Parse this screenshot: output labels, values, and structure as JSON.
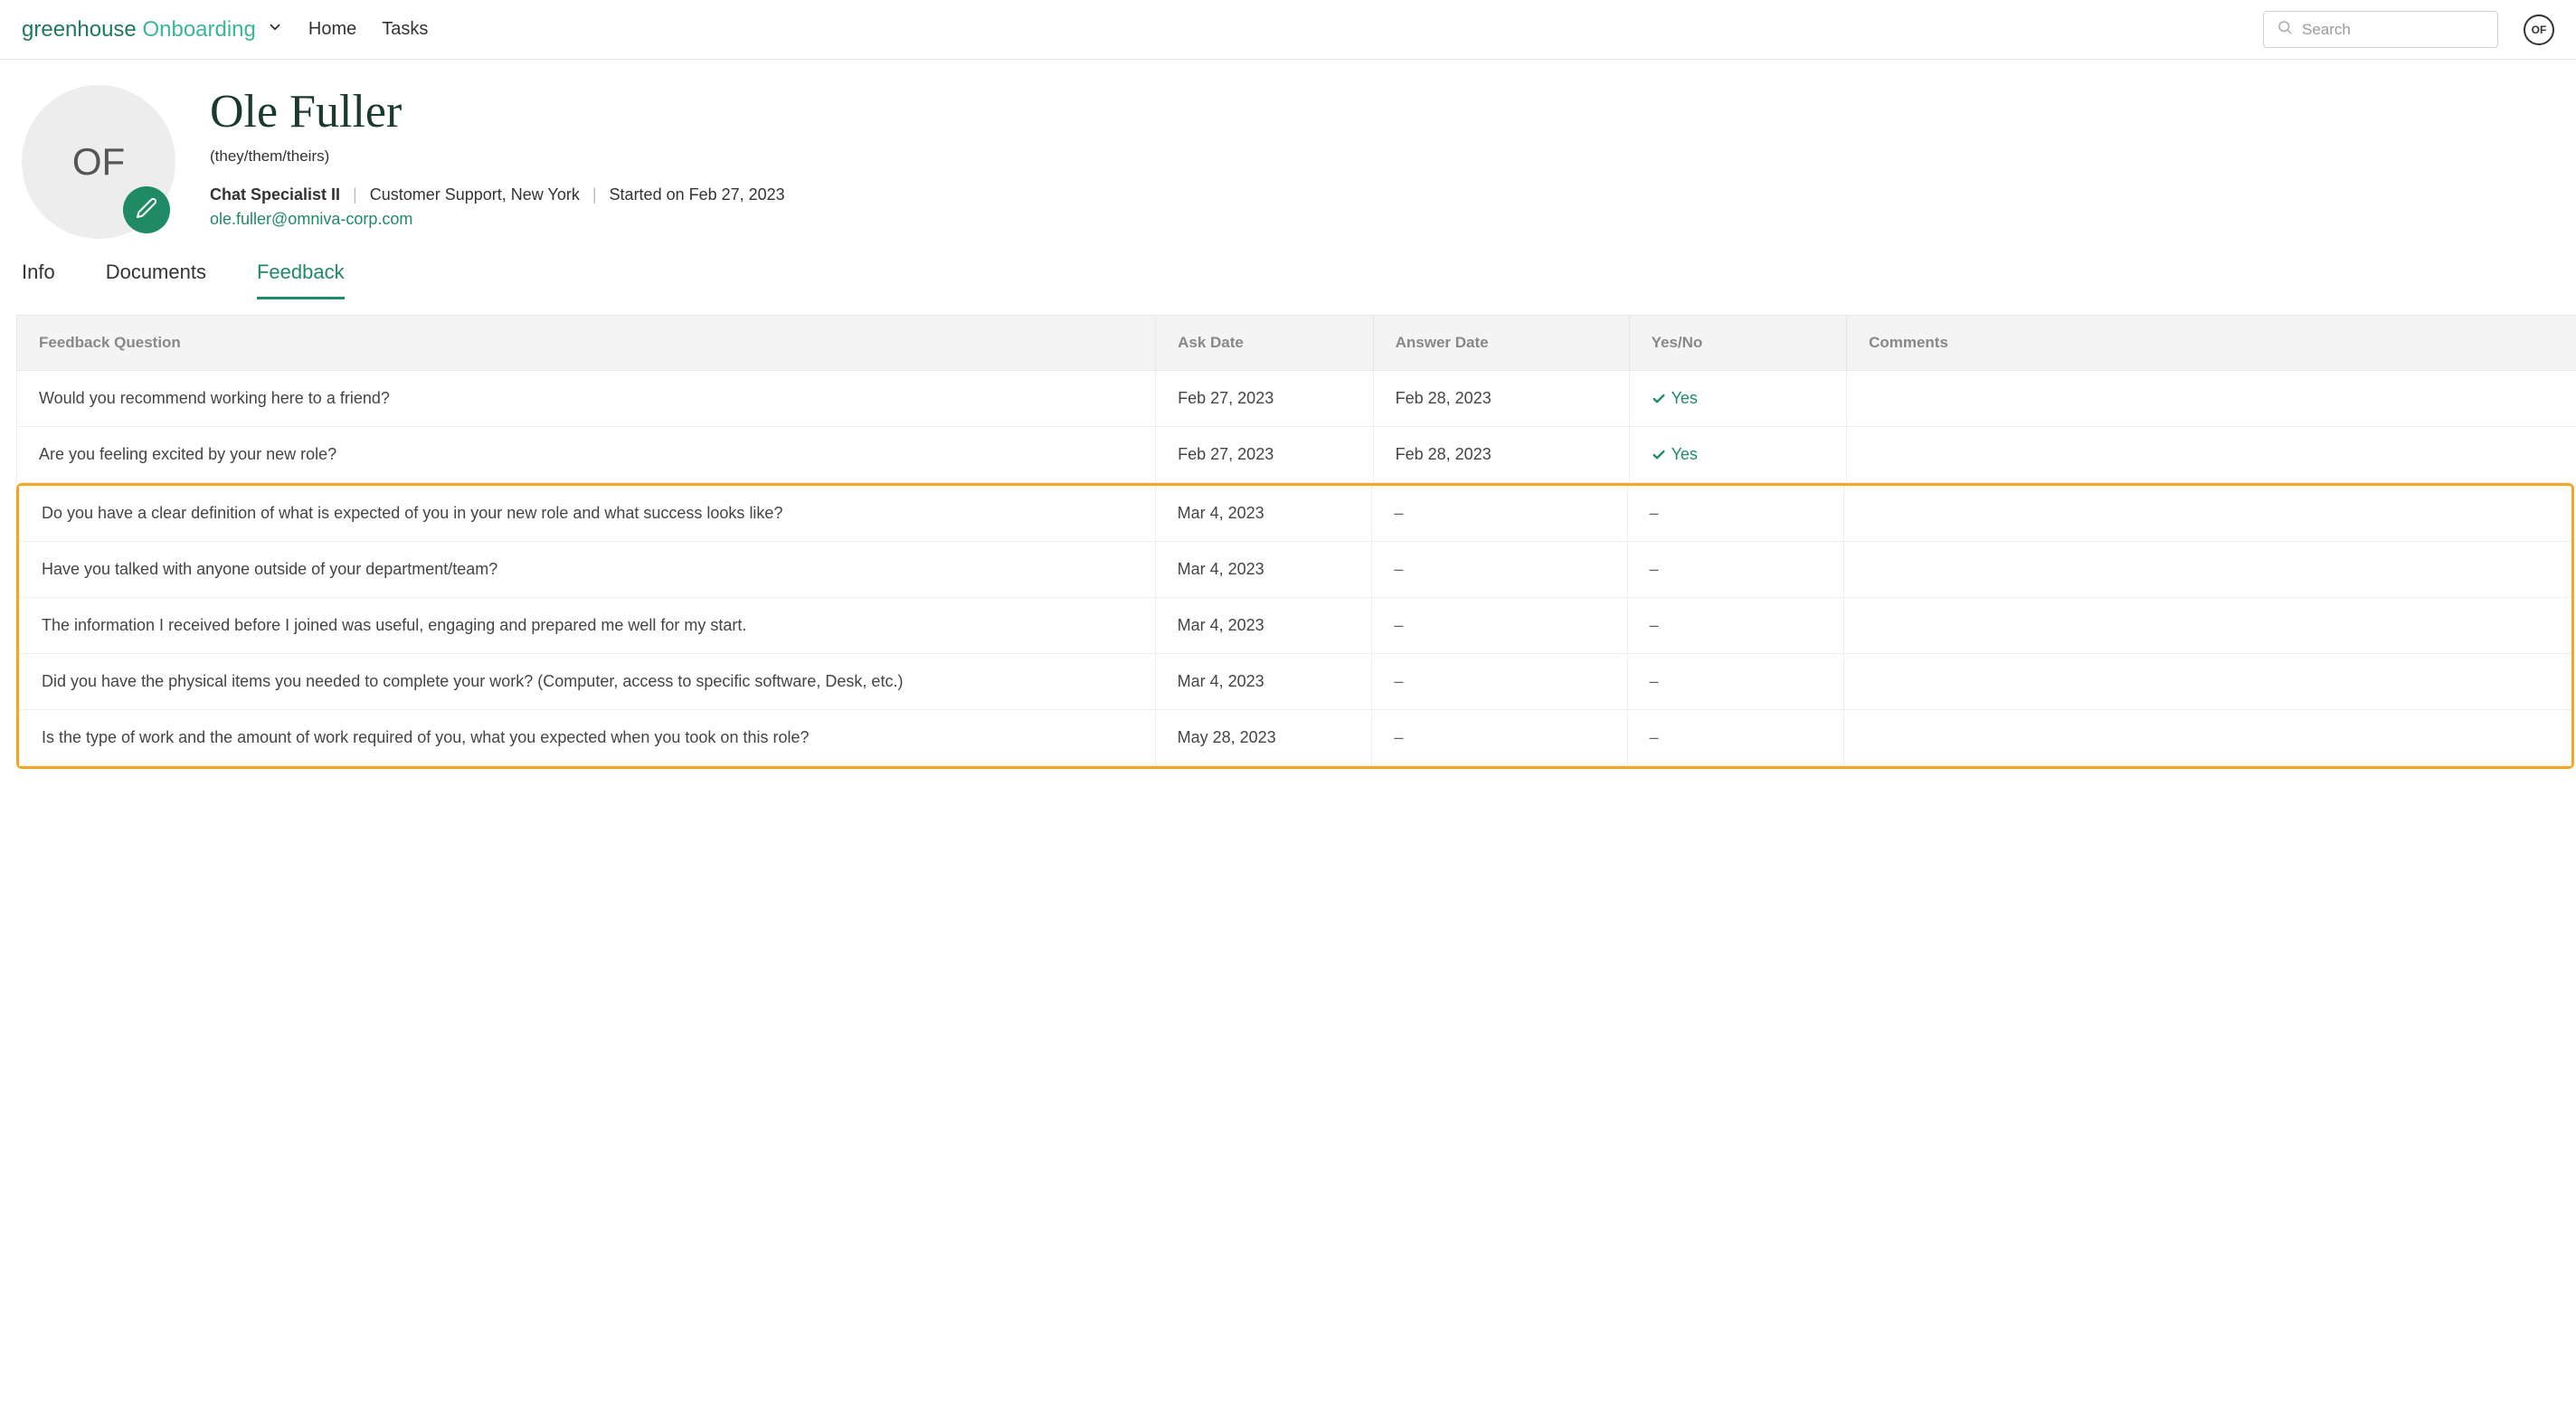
{
  "nav": {
    "logo_first": "greenhouse",
    "logo_second": "Onboarding",
    "home": "Home",
    "tasks": "Tasks",
    "search_placeholder": "Search",
    "avatar_initials": "OF"
  },
  "profile": {
    "avatar_initials": "OF",
    "name": "Ole Fuller",
    "pronouns": "(they/them/theirs)",
    "title": "Chat Specialist II",
    "department": "Customer Support, New York",
    "start": "Started on Feb 27, 2023",
    "email": "ole.fuller@omniva-corp.com"
  },
  "tabs": {
    "info": "Info",
    "documents": "Documents",
    "feedback": "Feedback"
  },
  "table": {
    "headers": {
      "question": "Feedback Question",
      "ask_date": "Ask Date",
      "answer_date": "Answer Date",
      "yesno": "Yes/No",
      "comments": "Comments"
    },
    "rows_top": [
      {
        "question": "Would you recommend working here to a friend?",
        "ask_date": "Feb 27, 2023",
        "answer_date": "Feb 28, 2023",
        "yesno": "Yes",
        "comments": ""
      },
      {
        "question": "Are you feeling excited by your new role?",
        "ask_date": "Feb 27, 2023",
        "answer_date": "Feb 28, 2023",
        "yesno": "Yes",
        "comments": ""
      }
    ],
    "rows_highlight": [
      {
        "question": "Do you have a clear definition of what is expected of you in your new role and what success looks like?",
        "ask_date": "Mar 4, 2023",
        "answer_date": "–",
        "yesno": "–",
        "comments": ""
      },
      {
        "question": "Have you talked with anyone outside of your department/team?",
        "ask_date": "Mar 4, 2023",
        "answer_date": "–",
        "yesno": "–",
        "comments": ""
      },
      {
        "question": "The information I received before I joined was useful, engaging and prepared me well for my start.",
        "ask_date": "Mar 4, 2023",
        "answer_date": "–",
        "yesno": "–",
        "comments": ""
      },
      {
        "question": "Did you have the physical items you needed to complete your work? (Computer, access to specific software, Desk, etc.)",
        "ask_date": "Mar 4, 2023",
        "answer_date": "–",
        "yesno": "–",
        "comments": ""
      },
      {
        "question": "Is the type of work and the amount of work required of you, what you expected when you took on this role?",
        "ask_date": "May 28, 2023",
        "answer_date": "–",
        "yesno": "–",
        "comments": ""
      }
    ]
  }
}
